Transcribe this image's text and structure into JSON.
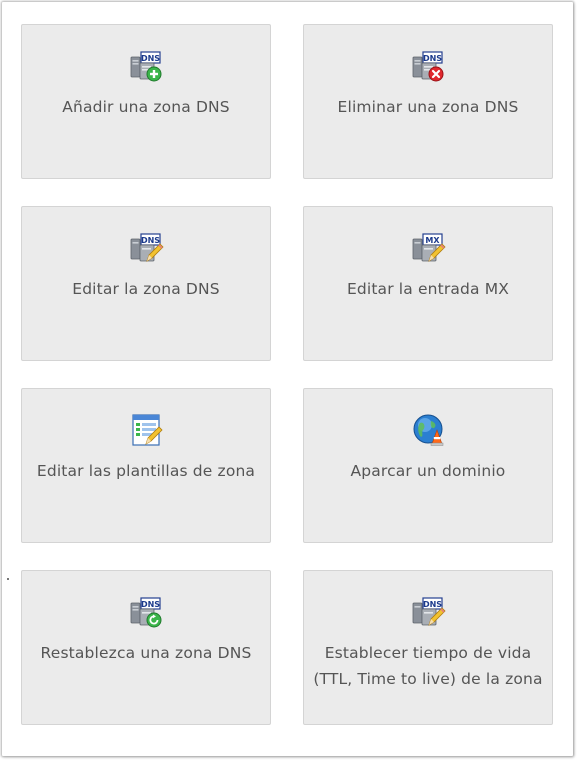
{
  "tiles": [
    {
      "label": "Añadir una zona DNS",
      "icon": "dns-add-icon"
    },
    {
      "label": "Eliminar una zona DNS",
      "icon": "dns-delete-icon"
    },
    {
      "label": "Editar la zona DNS",
      "icon": "dns-edit-icon"
    },
    {
      "label": "Editar la entrada MX",
      "icon": "mx-edit-icon"
    },
    {
      "label": "Editar las plantillas de zona",
      "icon": "template-edit-icon"
    },
    {
      "label": "Aparcar un dominio",
      "icon": "park-domain-icon"
    },
    {
      "label": "Restablezca una zona DNS",
      "icon": "dns-reset-icon"
    },
    {
      "label": "Establecer tiempo de vida (TTL, Time to live) de la zona",
      "icon": "dns-ttl-icon"
    }
  ],
  "icon_badges": {
    "dns": "DNS",
    "mx": "MX"
  },
  "colors": {
    "tile_background": "#ebebeb",
    "tile_border": "#d4d4d4",
    "label_text": "#555555",
    "add_badge": "#3bb54a",
    "delete_badge": "#e0282e",
    "reset_badge": "#3bb54a",
    "pencil": "#f2c230",
    "globe": "#2b7fd1"
  }
}
